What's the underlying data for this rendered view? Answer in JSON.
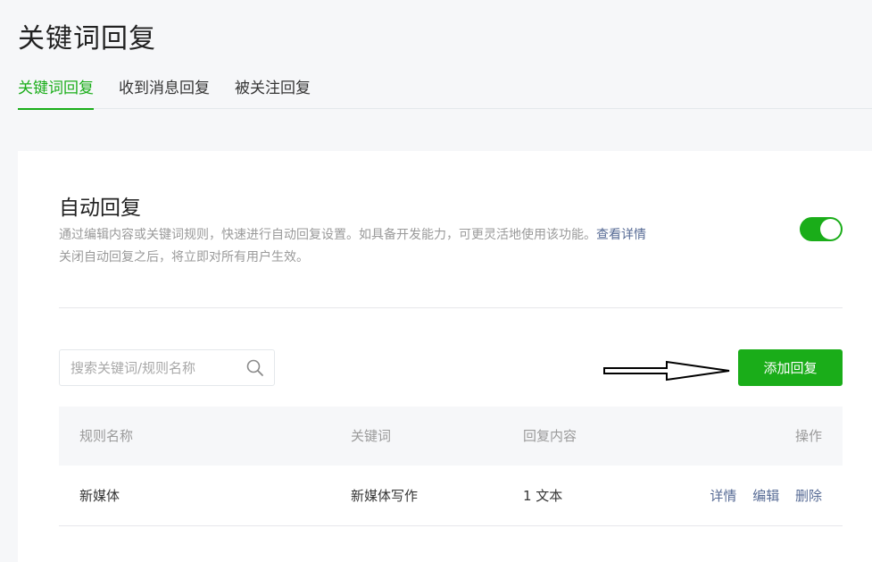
{
  "page": {
    "title": "关键词回复"
  },
  "tabs": [
    {
      "label": "关键词回复",
      "active": true
    },
    {
      "label": "收到消息回复",
      "active": false
    },
    {
      "label": "被关注回复",
      "active": false
    }
  ],
  "auto_reply": {
    "title": "自动回复",
    "desc_line1": "通过编辑内容或关键词规则，快速进行自动回复设置。如具备开发能力，可更灵活地使用该功能。",
    "desc_link": "查看详情",
    "desc_line2": "关闭自动回复之后，将立即对所有用户生效。",
    "enabled": true
  },
  "search": {
    "placeholder": "搜索关键词/规则名称",
    "value": ""
  },
  "add_button": {
    "label": "添加回复"
  },
  "table": {
    "headers": [
      "规则名称",
      "关键词",
      "回复内容",
      "操作"
    ],
    "rows": [
      {
        "name": "新媒体",
        "keyword": "新媒体写作",
        "content": "1 文本",
        "actions": [
          "详情",
          "编辑",
          "删除"
        ]
      }
    ]
  },
  "colors": {
    "accent": "#1aad19",
    "link": "#576b95"
  }
}
